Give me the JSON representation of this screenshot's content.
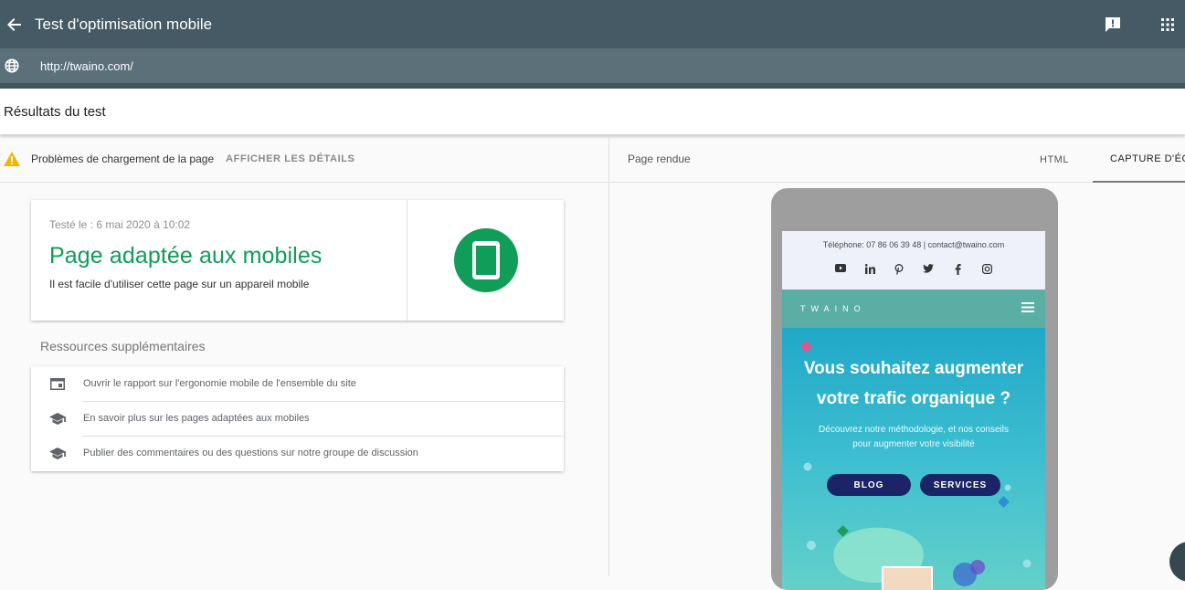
{
  "header": {
    "title": "Test d'optimisation mobile"
  },
  "urlbar": {
    "url": "http://twaino.com/"
  },
  "results": {
    "title": "Résultats du test",
    "issues_text": "Problèmes de chargement de la page",
    "details_link": "AFFICHER LES DÉTAILS"
  },
  "summary": {
    "tested_on": "Testé le : 6 mai 2020 à 10:02",
    "verdict": "Page adaptée aux mobiles",
    "verdict_sub": "Il est facile d'utiliser cette page sur un appareil mobile"
  },
  "resources": {
    "title": "Ressources supplémentaires",
    "items": [
      {
        "icon": "dashboard-icon",
        "label": "Ouvrir le rapport sur l'ergonomie mobile de l'ensemble du site"
      },
      {
        "icon": "school-icon",
        "label": "En savoir plus sur les pages adaptées aux mobiles"
      },
      {
        "icon": "school-icon",
        "label": "Publier des commentaires ou des questions sur notre groupe de discussion"
      }
    ]
  },
  "render": {
    "label": "Page rendue",
    "tabs": [
      "HTML",
      "CAPTURE D'ÉCRAN"
    ],
    "active_tab": "CAPTURE D'ÉCRAN"
  },
  "screenshot": {
    "contact": "Téléphone: 07 86 06 39 48 | contact@twaino.com",
    "brand": "TWAINO",
    "headline_1": "Vous souhaitez augmenter",
    "headline_2": "votre trafic organique ?",
    "text_1": "Découvrez notre méthodologie, et nos conseils",
    "text_2": "pour augmenter votre visibilité",
    "btn_blog": "BLOG",
    "btn_services": "SERVICES"
  },
  "colors": {
    "topbar": "#455a64",
    "success": "#0f9d58",
    "warning": "#f4b400"
  }
}
